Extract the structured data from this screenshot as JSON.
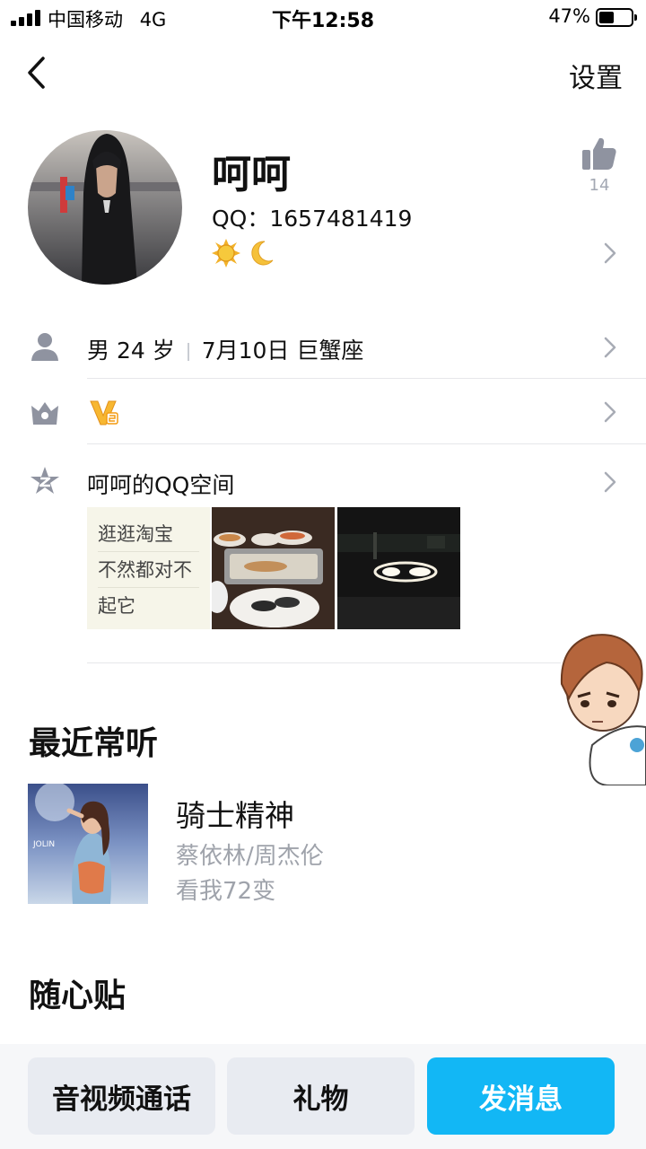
{
  "status_bar": {
    "carrier": "中国移动",
    "network": "4G",
    "time": "下午12:58",
    "battery_percent": "47%",
    "battery_level": 0.47
  },
  "nav": {
    "back_icon": "chevron-left-icon",
    "settings_label": "设置"
  },
  "profile": {
    "nickname": "呵呵",
    "qq_label": "QQ：",
    "qq_number": "1657481419",
    "status_icons": [
      "sun-icon",
      "moon-icon"
    ],
    "like_icon": "thumbs-up-icon",
    "like_count": "14"
  },
  "info_rows": [
    {
      "icon": "person-icon",
      "gender_age": "男 24 岁",
      "birthday": "7月10日 巨蟹座"
    },
    {
      "icon": "crown-icon",
      "badge_icon": "vip-badge-icon"
    },
    {
      "icon": "star-icon",
      "label": "呵呵的QQ空间",
      "thumb_text_lines": [
        "逛逛淘宝",
        "不然都对不",
        "起它"
      ]
    }
  ],
  "recent_music": {
    "title": "最近常听",
    "song": "骑士精神",
    "artist": "蔡依林/周杰伦",
    "album": "看我72变"
  },
  "sticker_section": {
    "title": "随心贴"
  },
  "bottom_buttons": {
    "call": "音视频通话",
    "gift": "礼物",
    "message": "发消息"
  },
  "colors": {
    "accent": "#12b7f5",
    "secondary_text": "#9fa3ab",
    "icon_gray": "#8f93a0"
  }
}
